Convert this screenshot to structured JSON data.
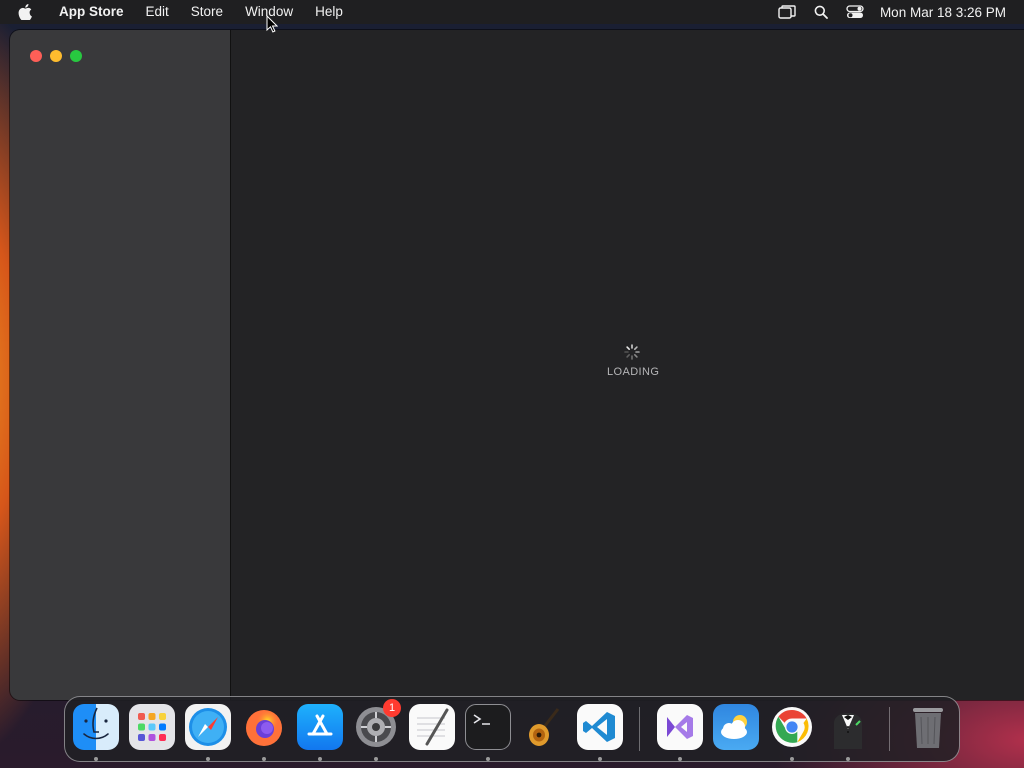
{
  "menubar": {
    "apple_icon": "apple-icon",
    "app_name": "App Store",
    "items": [
      "Edit",
      "Store",
      "Window",
      "Help"
    ],
    "status_icons": [
      "screen-mirroring-icon",
      "spotlight-search-icon",
      "control-center-icon"
    ],
    "clock": "Mon Mar 18  3:26 PM"
  },
  "window": {
    "state": "loading",
    "loading_text": "LOADING",
    "traffic_lights": {
      "close": "#fe5f57",
      "minimize": "#febc2e",
      "maximize": "#28c840"
    }
  },
  "dock": {
    "apps": [
      {
        "name": "Finder",
        "icon": "finder-icon",
        "running": true
      },
      {
        "name": "Launchpad",
        "icon": "launchpad-icon",
        "running": false
      },
      {
        "name": "Safari",
        "icon": "safari-icon",
        "running": true
      },
      {
        "name": "Firefox",
        "icon": "firefox-icon",
        "running": true
      },
      {
        "name": "App Store",
        "icon": "app-store-icon",
        "running": true
      },
      {
        "name": "System Settings",
        "icon": "system-settings-icon",
        "running": true,
        "badge": "1"
      },
      {
        "name": "TextEdit",
        "icon": "textedit-icon",
        "running": false
      },
      {
        "name": "Terminal",
        "icon": "terminal-icon",
        "running": true
      },
      {
        "name": "GarageBand",
        "icon": "garageband-icon",
        "running": false
      },
      {
        "name": "Visual Studio Code",
        "icon": "vscode-icon",
        "running": true
      },
      {
        "name": "Visual Studio",
        "icon": "visual-studio-icon",
        "running": true
      },
      {
        "name": "Weather",
        "icon": "weather-icon",
        "running": true
      },
      {
        "name": "Google Chrome",
        "icon": "chrome-icon",
        "running": true
      },
      {
        "name": "Bartender",
        "icon": "bartender-icon",
        "running": true
      },
      {
        "name": "Trash",
        "icon": "trash-icon",
        "running": false
      }
    ]
  }
}
